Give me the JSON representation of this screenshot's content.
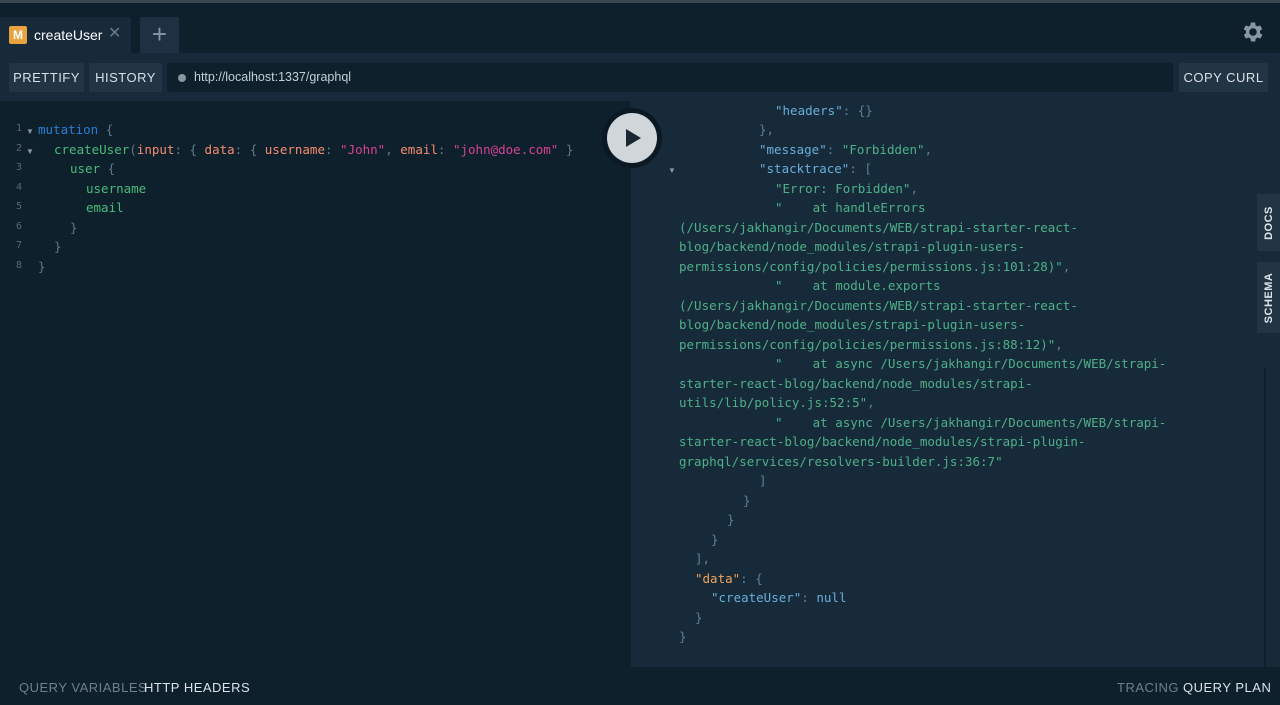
{
  "tab": {
    "badge": "M",
    "title": "createUser",
    "close": "✕",
    "add": "+"
  },
  "toolbar": {
    "prettify": "PRETTIFY",
    "history": "HISTORY",
    "url": "http://localhost:1337/graphql",
    "copy_curl": "COPY CURL"
  },
  "editor": {
    "line_numbers": [
      "1",
      "2",
      "3",
      "4",
      "5",
      "6",
      "7",
      "8"
    ],
    "mutation_kw": "mutation",
    "open_brace": "{",
    "field_createUser": "createUser",
    "paren_open": "(",
    "arg_input": "input",
    "colon_brace": ": {",
    "arg_data": "data",
    "arg_username": "username",
    "val_username": "\"John\"",
    "comma": ",",
    "arg_email": "email",
    "val_email": "\"john@doe.com\"",
    "close_brace_paren": "}",
    "field_user": "user",
    "field_username": "username",
    "field_email": "email",
    "close_brace": "}"
  },
  "result": {
    "lines": [
      {
        "indent": 12,
        "key": "",
        "text": "},"
      },
      {
        "indent": 12,
        "key": "\"headers\"",
        "text": ": {}"
      },
      {
        "indent": 10,
        "key": "",
        "text": "},"
      },
      {
        "indent": 10,
        "key": "\"message\"",
        "text": ": ",
        "str": "\"Forbidden\"",
        "tail": ","
      },
      {
        "indent": 10,
        "key": "\"stacktrace\"",
        "text": ": ["
      },
      {
        "indent": 12,
        "key": "",
        "str": "\"Error: Forbidden\"",
        "tail": ","
      },
      {
        "indent": 12,
        "key": "",
        "str": "\"    at handleErrors"
      },
      {
        "indent": 0,
        "key": "",
        "str": "(/Users/jakhangir/Documents/WEB/strapi-starter-react-"
      },
      {
        "indent": 0,
        "key": "",
        "str": "blog/backend/node_modules/strapi-plugin-users-"
      },
      {
        "indent": 0,
        "key": "",
        "str": "permissions/config/policies/permissions.js:101:28)\"",
        "tail": ","
      },
      {
        "indent": 12,
        "key": "",
        "str": "\"    at module.exports"
      },
      {
        "indent": 0,
        "key": "",
        "str": "(/Users/jakhangir/Documents/WEB/strapi-starter-react-"
      },
      {
        "indent": 0,
        "key": "",
        "str": "blog/backend/node_modules/strapi-plugin-users-"
      },
      {
        "indent": 0,
        "key": "",
        "str": "permissions/config/policies/permissions.js:88:12)\"",
        "tail": ","
      },
      {
        "indent": 12,
        "key": "",
        "str": "\"    at async /Users/jakhangir/Documents/WEB/strapi-"
      },
      {
        "indent": 0,
        "key": "",
        "str": "starter-react-blog/backend/node_modules/strapi-"
      },
      {
        "indent": 0,
        "key": "",
        "str": "utils/lib/policy.js:52:5\"",
        "tail": ","
      },
      {
        "indent": 12,
        "key": "",
        "str": "\"    at async /Users/jakhangir/Documents/WEB/strapi-"
      },
      {
        "indent": 0,
        "key": "",
        "str": "starter-react-blog/backend/node_modules/strapi-plugin-"
      },
      {
        "indent": 0,
        "key": "",
        "str": "graphql/services/resolvers-builder.js:36:7\""
      },
      {
        "indent": 10,
        "key": "",
        "text": "]"
      },
      {
        "indent": 8,
        "key": "",
        "text": "}"
      },
      {
        "indent": 6,
        "key": "",
        "text": "}"
      },
      {
        "indent": 4,
        "key": "",
        "text": "}"
      },
      {
        "indent": 2,
        "key": "",
        "text": "],"
      },
      {
        "indent": 2,
        "key": "\"data\"",
        "keycolor": "orange",
        "text": ": {"
      },
      {
        "indent": 4,
        "key": "\"createUser\"",
        "text": ": ",
        "null": "null"
      },
      {
        "indent": 2,
        "key": "",
        "text": "}"
      },
      {
        "indent": 0,
        "key": "",
        "text": "}"
      }
    ]
  },
  "side": {
    "docs": "DOCS",
    "schema": "SCHEMA"
  },
  "bottom": {
    "query_variables": "QUERY VARIABLES",
    "http_headers": "HTTP HEADERS",
    "tracing": "TRACING",
    "query_plan": "QUERY PLAN"
  },
  "icons": {
    "gear": "gear-icon",
    "run": "play-icon",
    "fold": "fold-arrow-icon"
  },
  "colors": {
    "accent_badge": "#e8a23f",
    "bg": "#172a3a",
    "editor_bg": "#0f202d"
  }
}
